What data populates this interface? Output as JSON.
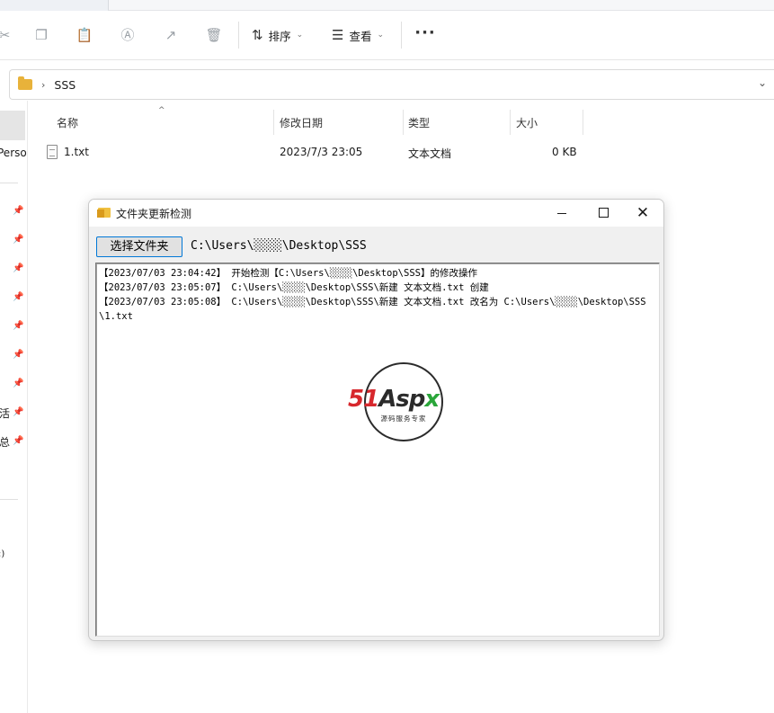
{
  "explorer": {
    "toolbar": {
      "sort_label": "排序",
      "view_label": "查看",
      "more_label": "···"
    },
    "address": {
      "crumb": "SSS"
    },
    "nav": {
      "partial_labels": [
        "Perso",
        "活",
        "总",
        ":)"
      ]
    },
    "columns": {
      "name": "名称",
      "modified": "修改日期",
      "type": "类型",
      "size": "大小"
    },
    "files": [
      {
        "name": "1.txt",
        "modified": "2023/7/3 23:05",
        "type": "文本文档",
        "size": "0 KB"
      }
    ]
  },
  "dialog": {
    "title": "文件夹更新检测",
    "choose_button": "选择文件夹",
    "path": "C:\\Users\\░░░░\\Desktop\\SSS",
    "log": [
      "【2023/07/03 23:04:42】 开始检测【C:\\Users\\░░░░\\Desktop\\SSS】的修改操作",
      "【2023/07/03 23:05:07】 C:\\Users\\░░░░\\Desktop\\SSS\\新建 文本文档.txt 创建",
      "【2023/07/03 23:05:08】 C:\\Users\\░░░░\\Desktop\\SSS\\新建 文本文档.txt 改名为 C:\\Users\\░░░░\\Desktop\\SSS\\1.txt"
    ],
    "watermark": {
      "brand_red": "51",
      "brand_dark": "Asp",
      "brand_green": "x",
      "tagline": "源码服务专家"
    }
  }
}
